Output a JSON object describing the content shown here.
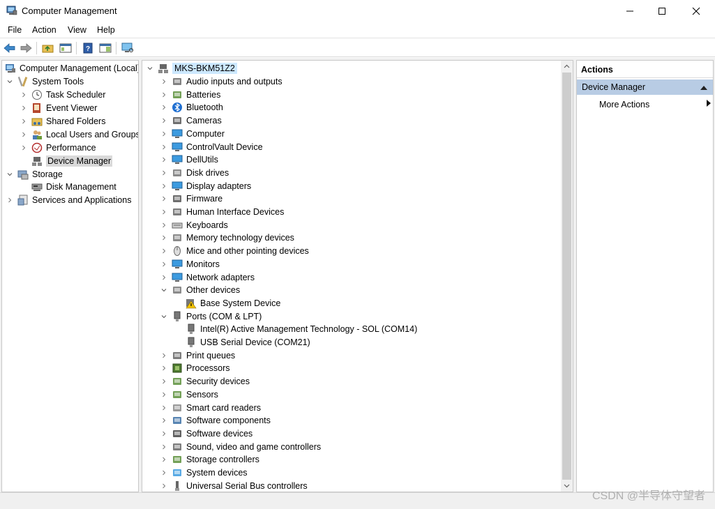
{
  "window": {
    "title": "Computer Management"
  },
  "menu": [
    "File",
    "Action",
    "View",
    "Help"
  ],
  "left_tree": {
    "root": "Computer Management (Local)",
    "system_tools": "System Tools",
    "task_scheduler": "Task Scheduler",
    "event_viewer": "Event Viewer",
    "shared_folders": "Shared Folders",
    "local_users": "Local Users and Groups",
    "performance": "Performance",
    "device_manager": "Device Manager",
    "storage": "Storage",
    "disk_management": "Disk Management",
    "services": "Services and Applications"
  },
  "device_tree": {
    "computer_name": "MKS-BKM51Z2",
    "categories": [
      "Audio inputs and outputs",
      "Batteries",
      "Bluetooth",
      "Cameras",
      "Computer",
      "ControlVault Device",
      "DellUtils",
      "Disk drives",
      "Display adapters",
      "Firmware",
      "Human Interface Devices",
      "Keyboards",
      "Memory technology devices",
      "Mice and other pointing devices",
      "Monitors",
      "Network adapters",
      "Other devices",
      "Base System Device",
      "Ports (COM & LPT)",
      "Intel(R) Active Management Technology - SOL (COM14)",
      "USB Serial Device (COM21)",
      "Print queues",
      "Processors",
      "Security devices",
      "Sensors",
      "Smart card readers",
      "Software components",
      "Software devices",
      "Sound, video and game controllers",
      "Storage controllers",
      "System devices",
      "Universal Serial Bus controllers"
    ]
  },
  "actions": {
    "header": "Actions",
    "section": "Device Manager",
    "more": "More Actions"
  },
  "watermark": "CSDN @半导体守望者",
  "colors": {
    "selection": "#cce8ff",
    "actions_section": "#b8cce4",
    "tree_selection": "#d9d9d9"
  }
}
